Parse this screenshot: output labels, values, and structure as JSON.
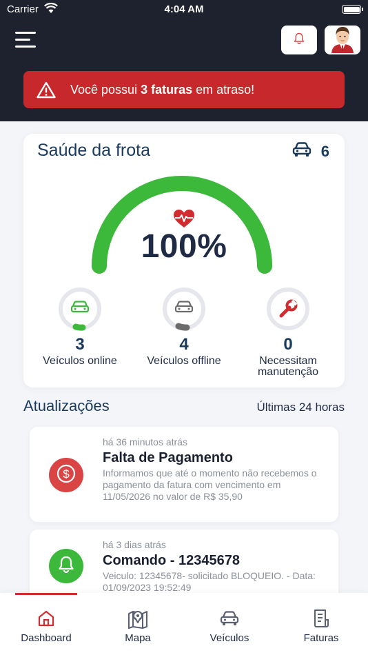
{
  "status_bar": {
    "carrier": "Carrier",
    "time": "4:04 AM"
  },
  "alert": {
    "prefix": "Você possui ",
    "highlight": "3 faturas",
    "suffix": " em atraso!"
  },
  "fleet": {
    "title": "Saúde da frota",
    "vehicle_count": "6",
    "health_percent": "100%",
    "health_fraction": 1.0,
    "stats": [
      {
        "value": "3",
        "label": "Veículos online",
        "color": "#3cb83a"
      },
      {
        "value": "4",
        "label": "Veículos offline",
        "color": "#6b6b6b"
      },
      {
        "value": "0",
        "label": "Necessitam manutenção",
        "color": "#d12c2f"
      }
    ]
  },
  "updates": {
    "title": "Atualizações",
    "range": "Últimas 24 horas",
    "items": [
      {
        "time": "há 36 minutos atrás",
        "title": "Falta de Pagamento",
        "description": "Informamos que até o momento não recebemos o pagamento da fatura com vencimento em 11/05/2026 no valor de R$ 35,90",
        "icon": "dollar-icon",
        "color": "#d94545"
      },
      {
        "time": "há 3 dias atrás",
        "title": "Comando -  12345678",
        "description": "Veiculo: 12345678- solicitado BLOQUEIO. - Data: 01/09/2023 19:52:49",
        "icon": "bell-icon",
        "color": "#3cb83a"
      }
    ]
  },
  "tabs": [
    {
      "label": "Dashboard",
      "icon": "home-icon",
      "active": true
    },
    {
      "label": "Mapa",
      "icon": "map-icon",
      "active": false
    },
    {
      "label": "Veículos",
      "icon": "car-icon",
      "active": false
    },
    {
      "label": "Faturas",
      "icon": "invoice-icon",
      "active": false
    }
  ],
  "colors": {
    "header_bg": "#1e222e",
    "alert_bg": "#c7282b",
    "gauge": "#3cb83a",
    "accent": "#d12c2f"
  }
}
